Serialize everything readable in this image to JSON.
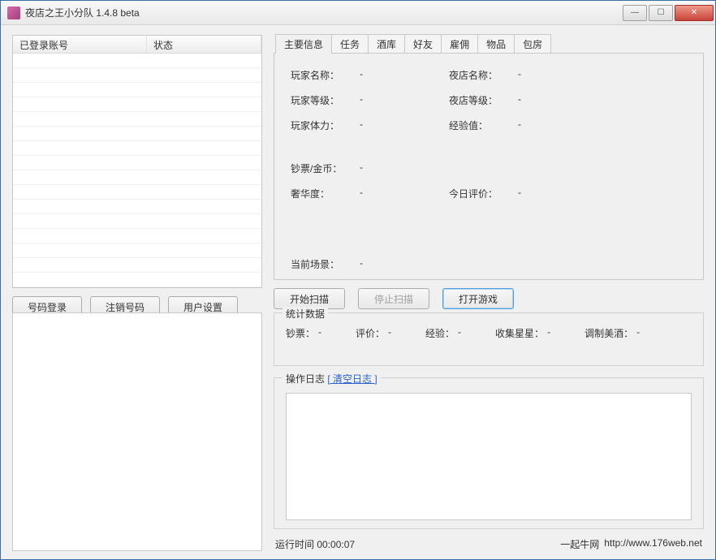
{
  "window": {
    "title": "夜店之王小分队 1.4.8 beta"
  },
  "table": {
    "col1": "已登录账号",
    "col2": "状态"
  },
  "left_buttons": {
    "login": "号码登录",
    "logout": "注销号码",
    "settings": "用户设置"
  },
  "tabs": [
    "主要信息",
    "任务",
    "酒库",
    "好友",
    "雇佣",
    "物品",
    "包房"
  ],
  "main_info": {
    "player_name_label": "玩家名称：",
    "player_name_val": "-",
    "club_name_label": "夜店名称：",
    "club_name_val": "-",
    "player_level_label": "玩家等级：",
    "player_level_val": "-",
    "club_level_label": "夜店等级：",
    "club_level_val": "-",
    "stamina_label": "玩家体力：",
    "stamina_val": "-",
    "exp_label": "经验值：",
    "exp_val": "-",
    "money_label": "钞票/金币：",
    "money_val": "-",
    "luxury_label": "奢华度：",
    "luxury_val": "-",
    "rating_label": "今日评价：",
    "rating_val": "-",
    "scene_label": "当前场景：",
    "scene_val": "-"
  },
  "scan_buttons": {
    "start": "开始扫描",
    "stop": "停止扫描",
    "open_game": "打开游戏"
  },
  "stats": {
    "group_title": "统计数据",
    "bills_label": "钞票：",
    "bills_val": "-",
    "rating_label": "评价：",
    "rating_val": "-",
    "exp_label": "经验：",
    "exp_val": "-",
    "stars_label": "收集星星：",
    "stars_val": "-",
    "wine_label": "调制美酒：",
    "wine_val": "-"
  },
  "log": {
    "title_prefix": "操作日志 ",
    "clear_link": "[ 清空日志 ]"
  },
  "status": {
    "runtime_label": "运行时间 ",
    "runtime_val": "00:00:07",
    "site_name": "一起牛网",
    "site_url": "http://www.176web.net"
  }
}
